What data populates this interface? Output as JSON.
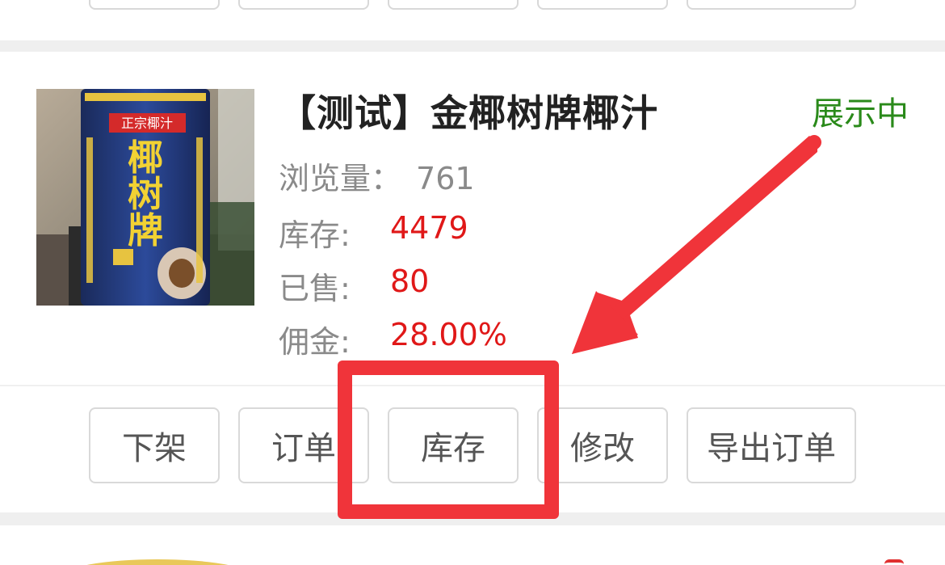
{
  "product": {
    "title": "【测试】金椰树牌椰汁",
    "status": "展示中",
    "views_label": "浏览量：",
    "views_value": "761",
    "stock_label": "库存:",
    "stock_value": "4479",
    "sold_label": "已售:",
    "sold_value": "80",
    "commission_label": "佣金:",
    "commission_value": "28.00%",
    "image_icon": "coconut-juice-product-photo"
  },
  "actions": {
    "delist": "下架",
    "orders": "订单",
    "inventory": "库存",
    "edit": "修改",
    "export_orders": "导出订单"
  },
  "colors": {
    "status_green": "#2a8a1a",
    "value_red": "#e01818",
    "annotation_red": "#f0343a",
    "label_gray": "#8a8a8a"
  }
}
